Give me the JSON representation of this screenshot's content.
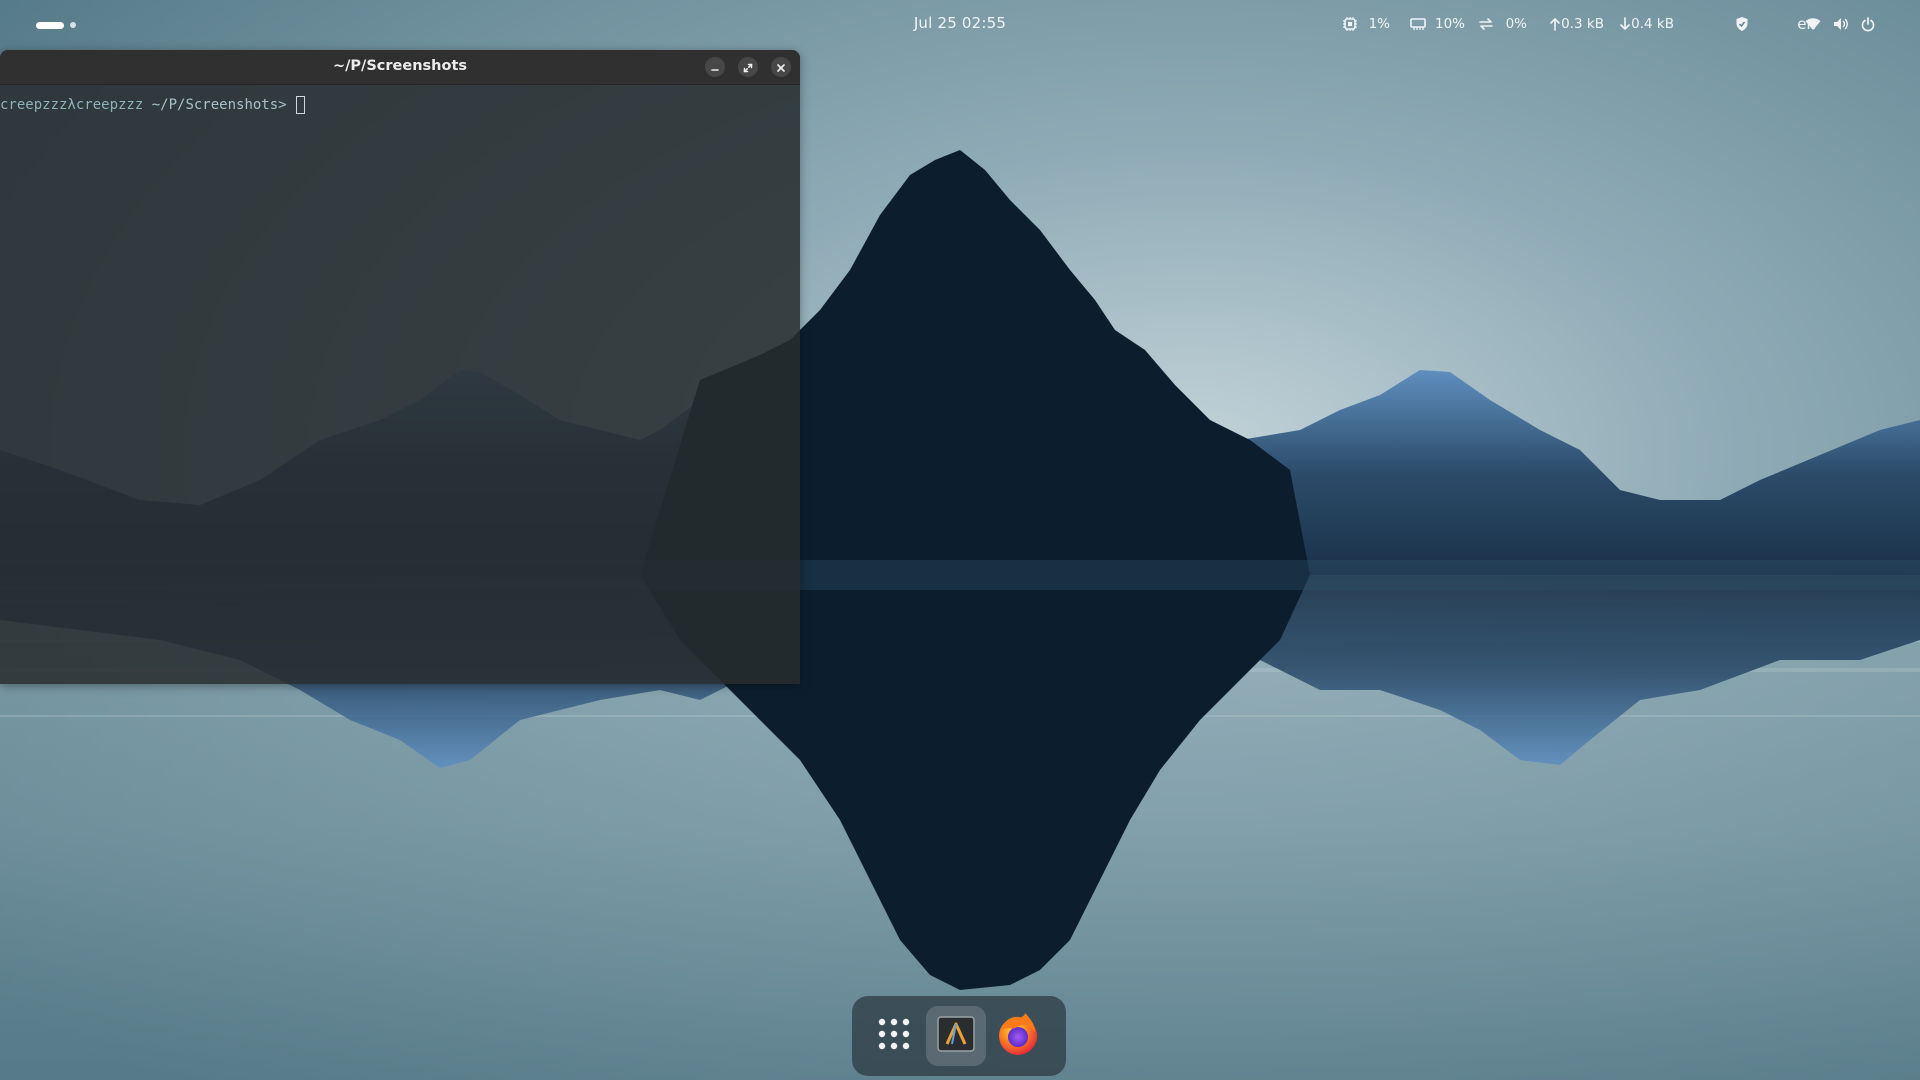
{
  "topbar": {
    "clock": "Jul 25  02:55",
    "cpu": "1%",
    "memory": "10%",
    "swap": "0%",
    "upload": "0.3 kB",
    "download": "0.4 kB",
    "keyboard_layout": "en",
    "workspaces": {
      "count": 2,
      "active": 1
    },
    "icons": [
      "cpu-icon",
      "memory-icon",
      "swap-icon",
      "upload-arrow-icon",
      "download-arrow-icon",
      "shield-icon",
      "wifi-icon",
      "volume-icon",
      "power-icon"
    ]
  },
  "terminal": {
    "title": "~/P/Screenshots",
    "prompt_user": "creepzzzλcreepzzz",
    "prompt_path": " ~/P/Screenshots>",
    "icons": [
      "minimize-icon",
      "maximize-icon",
      "close-icon"
    ]
  },
  "dock": {
    "items": [
      {
        "name": "Show Applications",
        "icon": "app-grid-icon"
      },
      {
        "name": "Terminal",
        "icon": "terminal-icon",
        "active": true
      },
      {
        "name": "Firefox",
        "icon": "firefox-icon"
      }
    ]
  },
  "colors": {
    "accent": "#6fa8dc",
    "terminal_bg": "#2c3032",
    "mountain_dark": "#0c1e2e",
    "sky_light": "#b9ccd3"
  }
}
